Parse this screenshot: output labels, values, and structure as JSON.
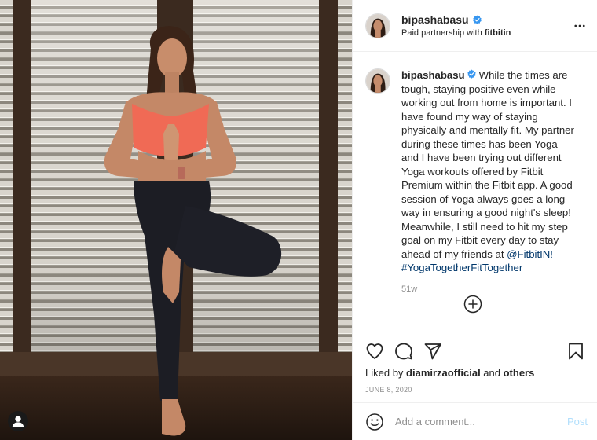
{
  "post": {
    "username": "bipashabasu",
    "partnership_prefix": "Paid partnership with ",
    "partner": "fitbitin",
    "caption_user": "bipashabasu",
    "caption_text": "While the times are tough, staying positive even while working out from home is important. I have found my way of staying physically and mentally fit. My partner during these times has been Yoga and I have been trying out different Yoga workouts offered by Fitbit Premium within the Fitbit app. A good session of Yoga always goes a long way in ensuring a good night's sleep! Meanwhile, I still need to hit my step goal on my Fitbit every day to stay ahead of my friends at",
    "mention": "@FitbitIN!",
    "hashtag": "#YogaTogetherFitTogether",
    "time_ago": "51w",
    "liked_by_prefix": "Liked by ",
    "liked_by_user": "diamirzaofficial",
    "liked_by_and": " and ",
    "liked_by_others": "others",
    "date": "JUNE 8, 2020"
  },
  "comment_box": {
    "placeholder": "Add a comment...",
    "post_label": "Post"
  },
  "icons": {
    "verified": "verified-badge-icon",
    "more": "more-options-icon",
    "load_more": "plus-circle-icon",
    "like": "heart-icon",
    "comment": "comment-bubble-icon",
    "share": "paper-plane-icon",
    "save": "bookmark-icon",
    "emoji": "smiley-icon",
    "photo_tag": "user-tag-icon"
  },
  "colors": {
    "verified_blue": "#3897f0",
    "link_blue": "#00376b",
    "post_button_disabled": "#b2dffc",
    "muted_text": "#8e8e8e",
    "border": "#efefef"
  }
}
